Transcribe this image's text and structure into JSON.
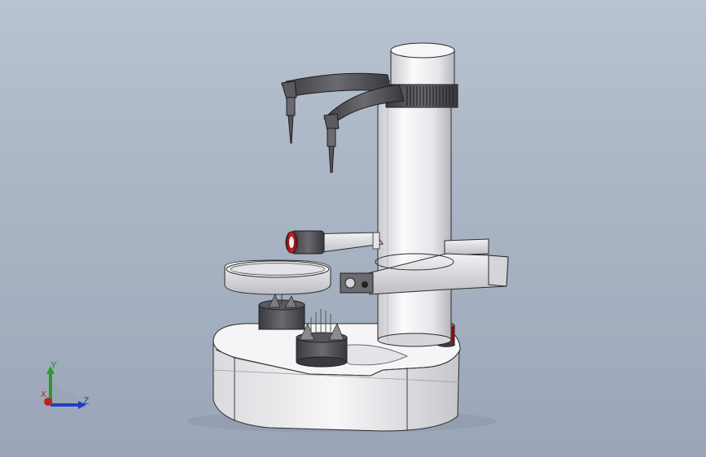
{
  "viewport": {
    "background_top": "#b8c2d0",
    "background_bottom": "#9aa6b8"
  },
  "colors": {
    "body": "#f2f2f4",
    "body_shade": "#c9c9cf",
    "edge": "#2b2b2b",
    "dark_part": "#4a4a4e",
    "red_part": "#b01818",
    "axis_x": "#c02020",
    "axis_y": "#2a9a2a",
    "axis_z": "#2040c0"
  },
  "triad": {
    "x_label": "X",
    "y_label": "Y",
    "z_label": "Z"
  }
}
